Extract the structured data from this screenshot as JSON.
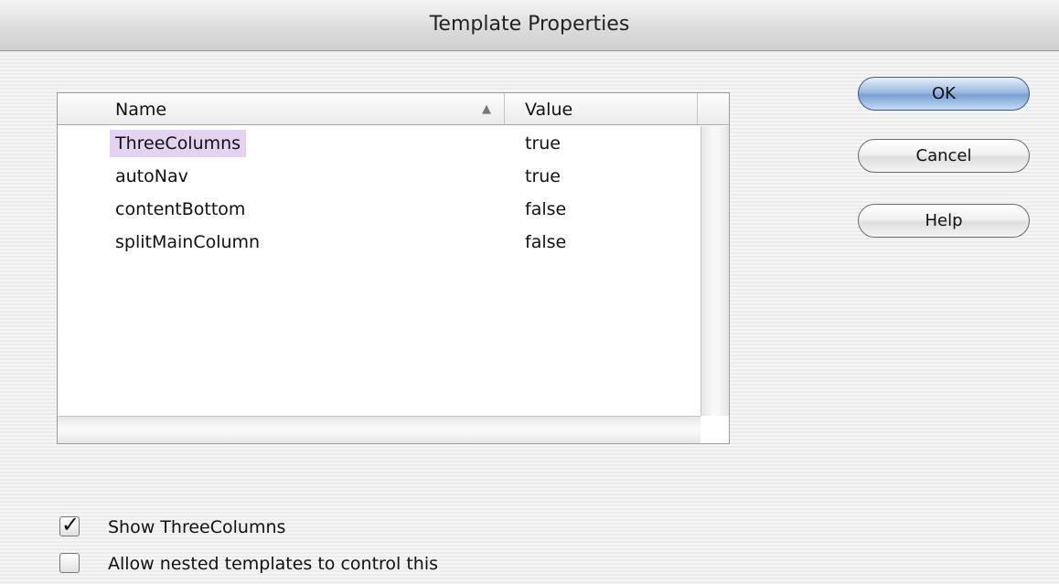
{
  "window": {
    "title": "Template Properties"
  },
  "table": {
    "columns": {
      "name": "Name",
      "value": "Value"
    },
    "rows": [
      {
        "name": "ThreeColumns",
        "value": "true"
      },
      {
        "name": "autoNav",
        "value": "true"
      },
      {
        "name": "contentBottom",
        "value": "false"
      },
      {
        "name": "splitMainColumn",
        "value": "false"
      }
    ],
    "selected_row": "ThreeColumns"
  },
  "buttons": {
    "ok": "OK",
    "cancel": "Cancel",
    "help": "Help"
  },
  "options": {
    "show": {
      "label": "Show ThreeColumns",
      "checked": true
    },
    "nested": {
      "label": "Allow nested templates to control this",
      "checked": false
    }
  },
  "colors": {
    "selection": "#e3d3f1",
    "default_button": "#7aa0d4"
  },
  "icons": {
    "sort": "sort-ascending-icon",
    "check": "checkmark-icon"
  }
}
